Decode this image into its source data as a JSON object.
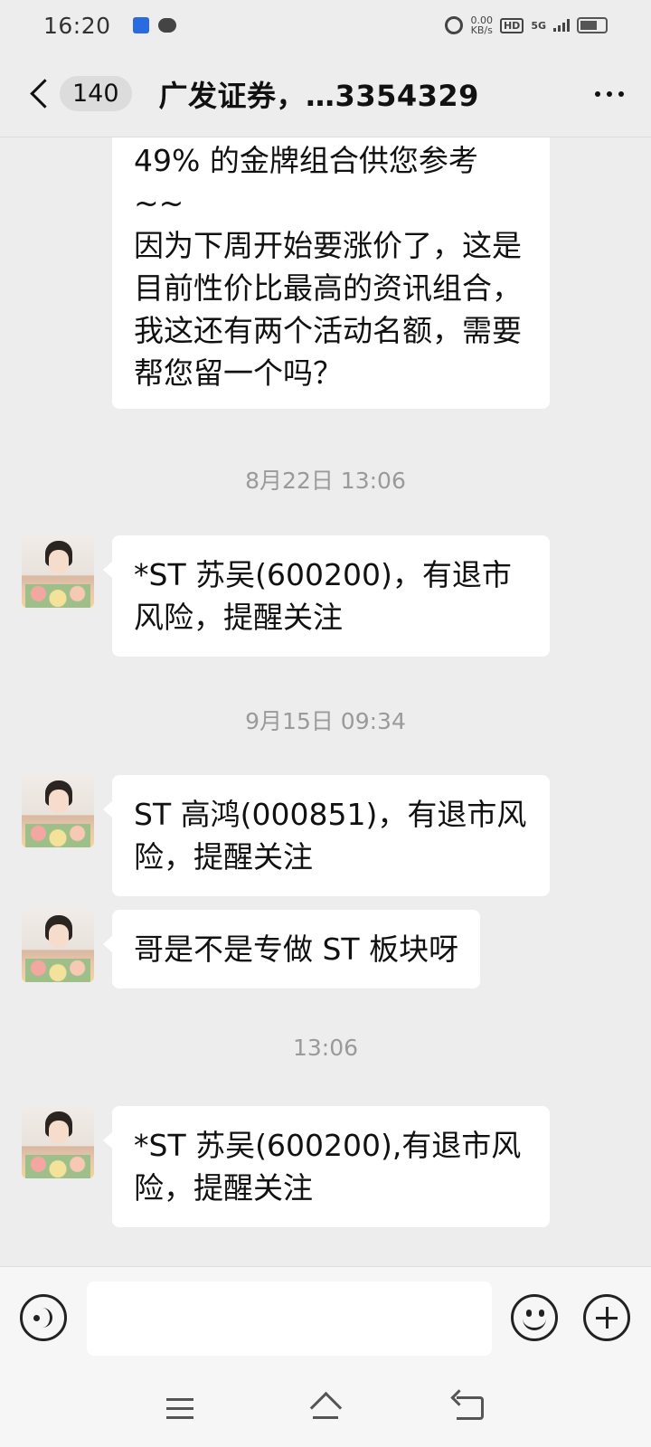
{
  "status_bar": {
    "time": "16:20",
    "net_speed_value": "0.00",
    "net_speed_unit": "KB/s",
    "hd_label": "HD",
    "network_label": "5G"
  },
  "header": {
    "unread_count": "140",
    "title": "广发证券，…3354329"
  },
  "messages": [
    {
      "type": "text",
      "text": "49% 的金牌组合供您参考~~\n因为下周开始要涨价了，这是目前性价比最高的资讯组合，我这还有两个活动名额，需要帮您留一个吗？"
    },
    {
      "type": "time",
      "text": "8月22日 13:06"
    },
    {
      "type": "text",
      "text": "*ST 苏吴(600200)，有退市风险，提醒关注"
    },
    {
      "type": "time",
      "text": "9月15日 09:34"
    },
    {
      "type": "text",
      "text": "ST 高鸿(000851)，有退市风险，提醒关注"
    },
    {
      "type": "text",
      "text": "哥是不是专做 ST 板块呀"
    },
    {
      "type": "time",
      "text": "13:06"
    },
    {
      "type": "text",
      "text": "*ST 苏吴(600200),有退市风险，提醒关注"
    }
  ],
  "input_bar": {
    "value": "",
    "placeholder": ""
  },
  "icons": {
    "back": "chevron-left-icon",
    "more": "more-dots-icon",
    "voice": "voice-icon",
    "emoji": "emoji-icon",
    "add": "plus-icon"
  }
}
